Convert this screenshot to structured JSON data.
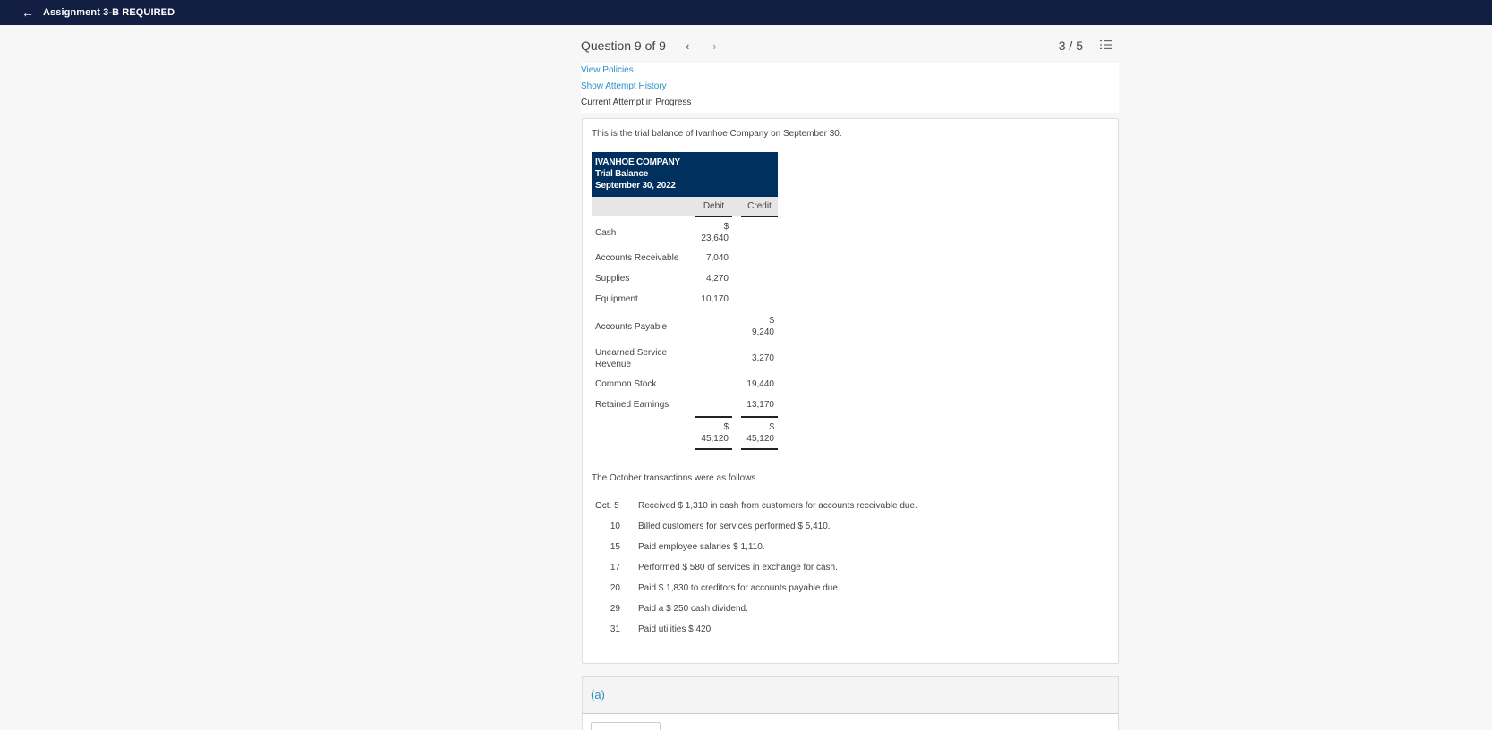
{
  "topbar": {
    "back_icon": "arrow-left-icon",
    "title": "Assignment 3-B REQUIRED"
  },
  "question_header": {
    "title": "Question 9 of 9",
    "prev_icon": "‹",
    "next_icon": "›",
    "score": "3 / 5",
    "list_icon": "numbered-list-icon"
  },
  "links": {
    "view_policies": "View Policies",
    "show_attempt_history": "Show Attempt History",
    "status": "Current Attempt in Progress"
  },
  "problem": {
    "intro": "This is the trial balance of Ivanhoe Company on September 30.",
    "trial_balance": {
      "company": "IVANHOE COMPANY",
      "statement": "Trial Balance",
      "date": "September 30, 2022",
      "columns": {
        "debit": "Debit",
        "credit": "Credit"
      },
      "rows": [
        {
          "account": "Cash",
          "debit_symbol": "$",
          "debit": "23,640",
          "credit_symbol": "",
          "credit": ""
        },
        {
          "account": "Accounts Receivable",
          "debit_symbol": "",
          "debit": "7,040",
          "credit_symbol": "",
          "credit": ""
        },
        {
          "account": "Supplies",
          "debit_symbol": "",
          "debit": "4,270",
          "credit_symbol": "",
          "credit": ""
        },
        {
          "account": "Equipment",
          "debit_symbol": "",
          "debit": "10,170",
          "credit_symbol": "",
          "credit": ""
        },
        {
          "account": "Accounts Payable",
          "debit_symbol": "",
          "debit": "",
          "credit_symbol": "$",
          "credit": "9,240"
        },
        {
          "account": "Unearned Service Revenue",
          "debit_symbol": "",
          "debit": "",
          "credit_symbol": "",
          "credit": "3,270"
        },
        {
          "account": "Common Stock",
          "debit_symbol": "",
          "debit": "",
          "credit_symbol": "",
          "credit": "19,440"
        },
        {
          "account": "Retained Earnings",
          "debit_symbol": "",
          "debit": "",
          "credit_symbol": "",
          "credit": "13,170"
        }
      ],
      "totals": {
        "debit_symbol": "$",
        "debit": "45,120",
        "credit_symbol": "$",
        "credit": "45,120"
      }
    },
    "transactions_intro": "The October transactions were as follows.",
    "transactions": [
      {
        "date": "Oct. 5",
        "description": "Received $ 1,310 in cash from customers for accounts receivable due."
      },
      {
        "date": "10",
        "description": "Billed customers for services performed $ 5,410."
      },
      {
        "date": "15",
        "description": "Paid employee salaries $ 1,110."
      },
      {
        "date": "17",
        "description": "Performed $ 580 of services in exchange for cash."
      },
      {
        "date": "20",
        "description": "Paid $ 1,830 to creditors for accounts payable due."
      },
      {
        "date": "29",
        "description": "Paid a $ 250 cash dividend."
      },
      {
        "date": "31",
        "description": "Paid utilities $ 420."
      }
    ]
  },
  "part": {
    "label": "(a)"
  }
}
